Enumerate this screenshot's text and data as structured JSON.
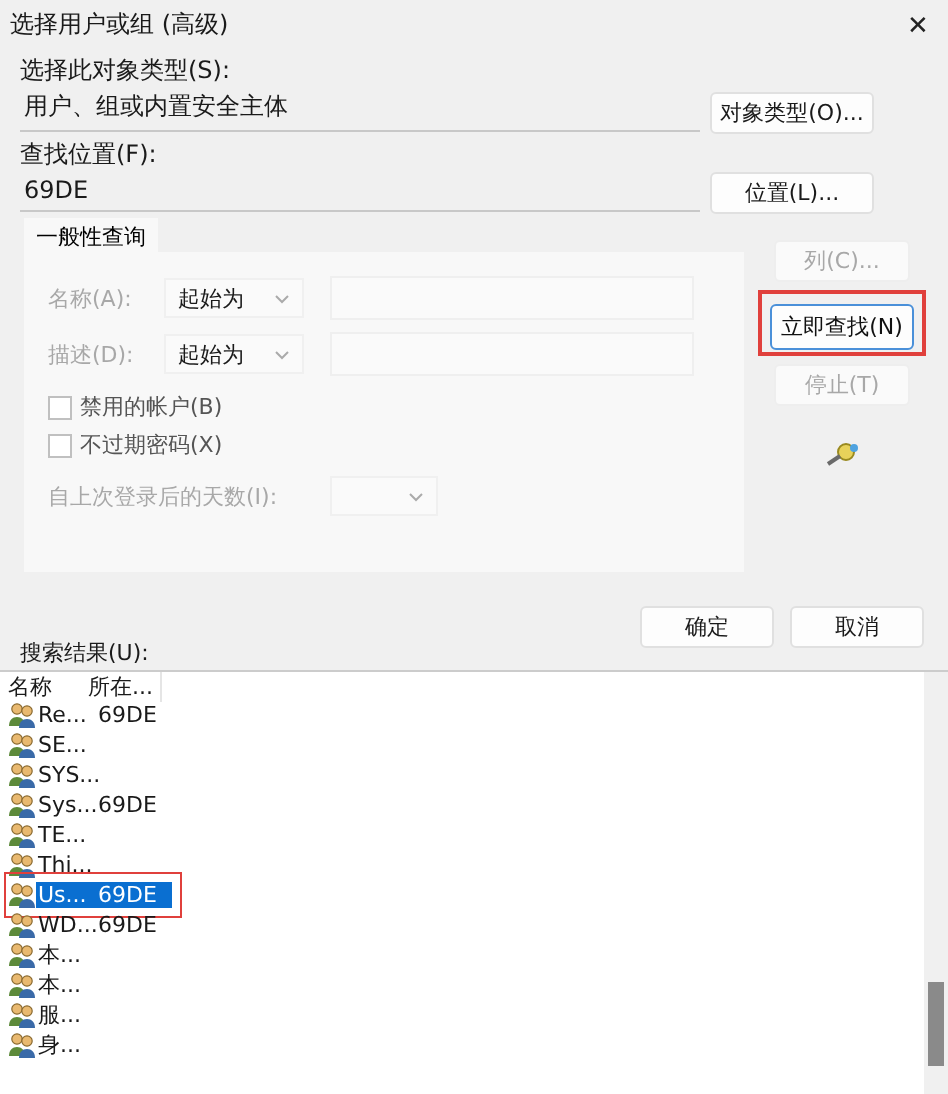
{
  "window": {
    "title": "选择用户或组 (高级)",
    "close": "✕"
  },
  "object_type": {
    "label": "选择此对象类型(S):",
    "value": "用户、组或内置安全主体",
    "button": "对象类型(O)..."
  },
  "location": {
    "label": "查找位置(F):",
    "value": "69DE",
    "button": "位置(L)..."
  },
  "query_tab": {
    "label": "一般性查询"
  },
  "query_fields": [
    {
      "kind": "text",
      "label": "名称(A):",
      "mode": "起始为",
      "disabled": true
    },
    {
      "kind": "text",
      "label": "描述(D):",
      "mode": "起始为",
      "disabled": true
    }
  ],
  "checkboxes": [
    {
      "label": "禁用的帐户(B)",
      "checked": false
    },
    {
      "label": "不过期密码(X)",
      "checked": false
    }
  ],
  "days": {
    "label": "自上次登录后的天数(I):",
    "disabled": true
  },
  "side_buttons": [
    {
      "kind": "button",
      "label": "列(C)...",
      "disabled": true,
      "highlighted": false
    },
    {
      "kind": "button",
      "label": "立即查找(N)",
      "disabled": false,
      "highlighted": true
    },
    {
      "kind": "button",
      "label": "停止(T)",
      "disabled": true,
      "highlighted": false
    },
    {
      "kind": "icon"
    }
  ],
  "dialog_buttons": [
    "确定",
    "取消"
  ],
  "results": {
    "label": "搜索结果(U):",
    "columns": [
      "名称",
      "所在..."
    ],
    "rows": [
      {
        "name": "Re...",
        "location": "69DE",
        "selected": false,
        "highlighted": false
      },
      {
        "name": "SE...",
        "selected": false,
        "highlighted": false
      },
      {
        "name": "SYS...",
        "selected": false,
        "highlighted": false
      },
      {
        "name": "Sys...",
        "location": "69DE",
        "selected": false,
        "highlighted": false
      },
      {
        "name": "TE...",
        "selected": false,
        "highlighted": false
      },
      {
        "name": "Thi...",
        "selected": false,
        "highlighted": false
      },
      {
        "name": "Us...",
        "location": "69DE",
        "selected": true,
        "highlighted": true
      },
      {
        "name": "WD...",
        "location": "69DE",
        "selected": false,
        "highlighted": false
      },
      {
        "name": "本...",
        "selected": false,
        "highlighted": false
      },
      {
        "name": "本...",
        "selected": false,
        "highlighted": false
      },
      {
        "name": "服...",
        "selected": false,
        "highlighted": false
      },
      {
        "name": "身...",
        "selected": false,
        "highlighted": false
      }
    ]
  }
}
